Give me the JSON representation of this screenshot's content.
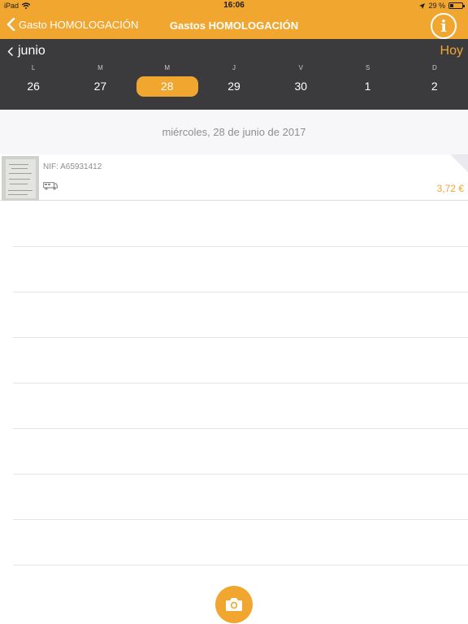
{
  "status_bar": {
    "device": "iPad",
    "time": "16:06",
    "battery": "29 %",
    "battery_level": 0.29
  },
  "nav": {
    "back_label": "Gasto HOMOLOGACIÓN",
    "title": "Gastos HOMOLOGACIÓN",
    "info_icon": "info-icon"
  },
  "calendar": {
    "month": "junio",
    "today_label": "Hoy",
    "weekdays": [
      "L",
      "M",
      "M",
      "J",
      "V",
      "S",
      "D"
    ],
    "days": [
      "26",
      "27",
      "28",
      "29",
      "30",
      "1",
      "2"
    ],
    "selected_day": "28"
  },
  "date_header": "miércoles, 28 de junio de 2017",
  "expenses": [
    {
      "nif": "NIF: A65931412",
      "category_icon": "van-icon",
      "amount": "3,72 €"
    }
  ],
  "camera_icon": "camera-icon",
  "colors": {
    "accent": "#f1a630",
    "dark": "#3b3b3d"
  }
}
